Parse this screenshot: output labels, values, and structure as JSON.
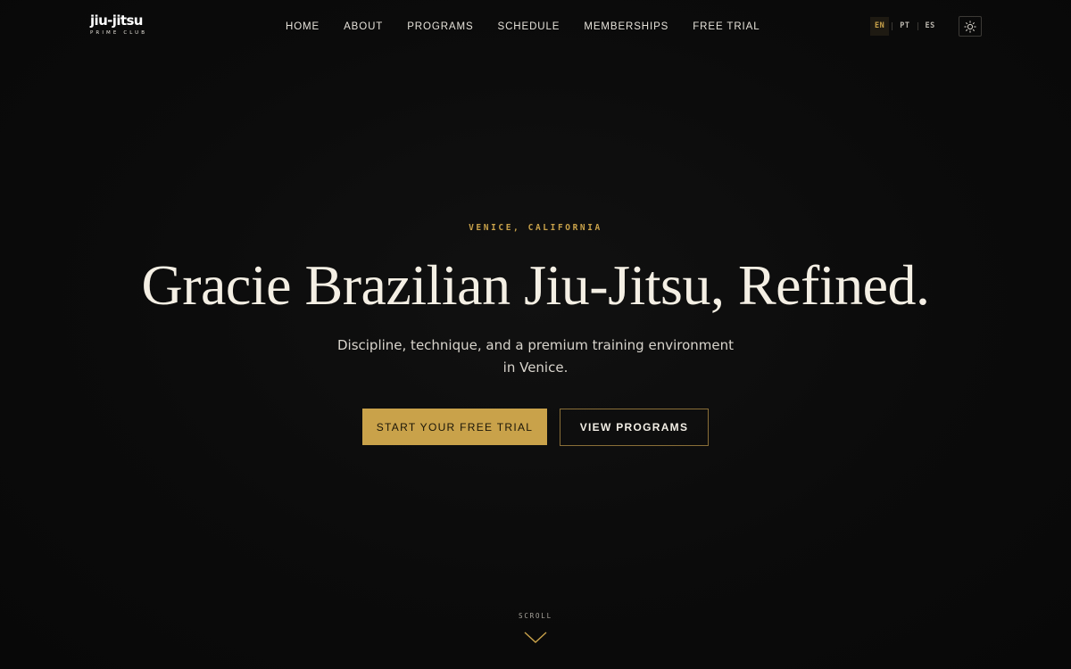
{
  "brand": {
    "logo_main": "jiu-jitsu",
    "logo_sub": "PRIME CLUB"
  },
  "nav": {
    "items": [
      {
        "label": "HOME"
      },
      {
        "label": "ABOUT"
      },
      {
        "label": "PROGRAMS"
      },
      {
        "label": "SCHEDULE"
      },
      {
        "label": "MEMBERSHIPS"
      },
      {
        "label": "FREE TRIAL"
      }
    ]
  },
  "language": {
    "options": [
      "EN",
      "PT",
      "ES"
    ],
    "selected": "EN"
  },
  "theme_toggle": {
    "icon": "sun-icon"
  },
  "hero": {
    "eyebrow": "VENICE, CALIFORNIA",
    "headline": "Gracie Brazilian Jiu-Jitsu, Refined.",
    "subtitle": "Discipline, technique, and a premium training environment in Venice.",
    "primary_cta": "START YOUR FREE TRIAL",
    "secondary_cta": "VIEW PROGRAMS"
  },
  "scroll": {
    "label": "SCROLL",
    "icon": "chevron-down-icon"
  },
  "colors": {
    "background": "#0a0a0a",
    "accent_gold": "#c9a24a",
    "text_light": "#f4efe4",
    "button_text_dark": "#1a1508"
  }
}
